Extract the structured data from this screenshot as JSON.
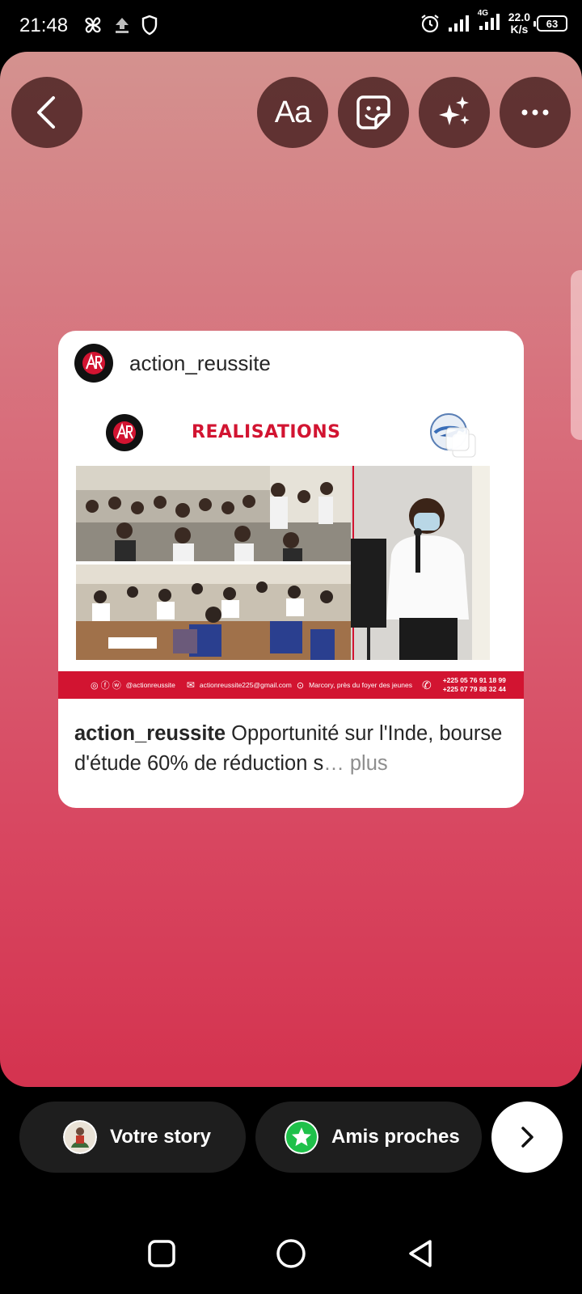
{
  "status_bar": {
    "time": "21:48",
    "network_type": "4G",
    "speed_value": "22.0",
    "speed_unit": "K/s",
    "battery": "63"
  },
  "toolbar": {
    "text_tool_label": "Aa"
  },
  "post": {
    "username": "action_reussite",
    "image_title": "REALISATIONS",
    "image_footer": {
      "handle": "@actionreussite",
      "email": "actionreussite225@gmail.com",
      "location": "Marcory, près du foyer des jeunes",
      "phone_1": "+225 05 76 91 18 99",
      "phone_2": "+225 07 79 88 32 44"
    },
    "caption_user": "action_reussite",
    "caption_text": " Opportunité sur l'Inde, bourse d'étude 60% de réduction s",
    "caption_ellipsis": "…",
    "caption_more": " plus"
  },
  "share_bar": {
    "your_story_label": "Votre story",
    "close_friends_label": "Amis proches"
  },
  "colors": {
    "brand_red": "#d21431",
    "close_friends_green": "#1fc14a"
  }
}
